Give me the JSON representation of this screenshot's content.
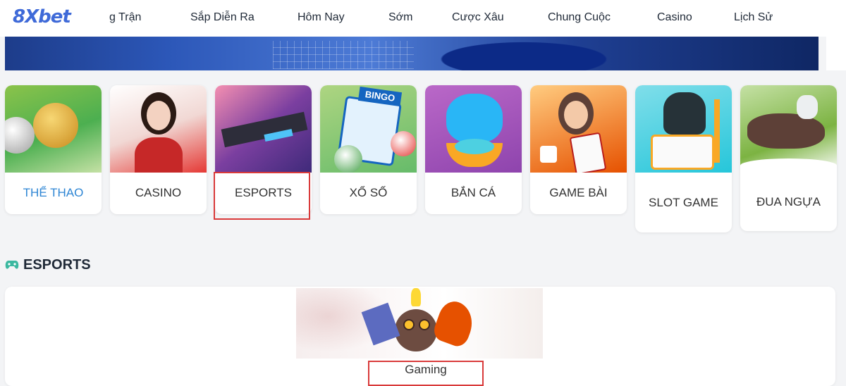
{
  "header": {
    "logo": "8Xbet",
    "nav": [
      {
        "label": "g Trận"
      },
      {
        "label": "Sắp Diễn Ra"
      },
      {
        "label": "Hôm Nay"
      },
      {
        "label": "Sớm"
      },
      {
        "label": "Cược Xâu"
      },
      {
        "label": "Chung Cuộc"
      },
      {
        "label": "Casino"
      },
      {
        "label": "Lịch Sử"
      }
    ]
  },
  "categories": [
    {
      "label": "THỂ THAO",
      "active": true,
      "icon": "soccer-trophy-icon"
    },
    {
      "label": "CASINO",
      "icon": "casino-dealer-icon"
    },
    {
      "label": "ESPORTS",
      "icon": "esports-warrior-icon",
      "highlighted": true
    },
    {
      "label": "XỔ SỐ",
      "icon": "bingo-lottery-icon"
    },
    {
      "label": "BẮN CÁ",
      "icon": "shark-fishing-icon"
    },
    {
      "label": "GAME BÀI",
      "icon": "mahjong-dice-icon"
    },
    {
      "label": "SLOT GAME",
      "icon": "slot-machine-icon"
    },
    {
      "label": "ĐUA NGỰA",
      "icon": "horse-racing-icon"
    }
  ],
  "section": {
    "title": "ESPORTS",
    "icon": "gamepad-icon",
    "items": [
      {
        "label": "Gaming",
        "icon": "gaming-character-icon"
      }
    ]
  },
  "colors": {
    "accent": "#2e86d4",
    "logo": "#3f6ad8",
    "highlight_border": "#d93a3a",
    "gamepad": "#3bb8a0"
  }
}
